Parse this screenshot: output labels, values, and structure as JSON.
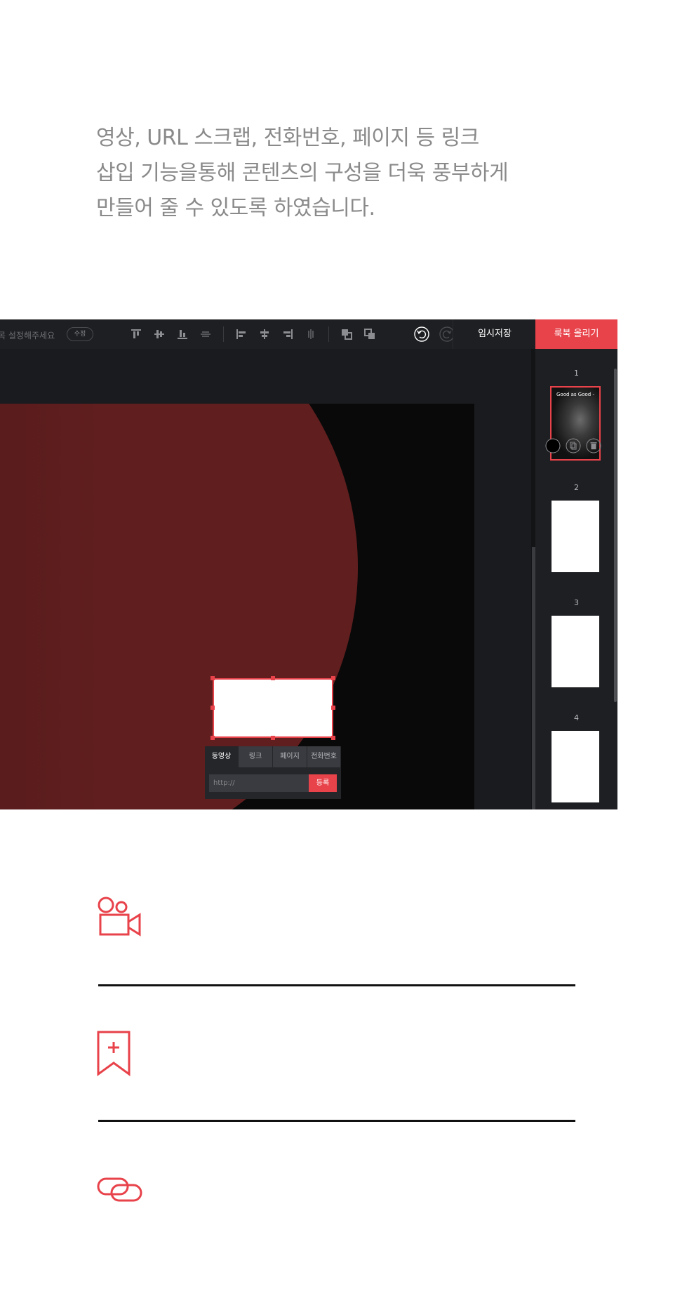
{
  "intro": {
    "lines": [
      "영상, URL 스크랩, 전화번호, 페이지 등 링크",
      "삽입 기능을통해 콘텐츠의 구성을 더욱 풍부하게",
      "만들어 줄 수 있도록 하였습니다."
    ]
  },
  "editor": {
    "title_text": "제목 설정해주세요",
    "edit_label": "수정",
    "save_label": "임시저장",
    "upload_label": "룩북 올리기",
    "toolbar_icons": [
      "align-top-icon",
      "align-middle-icon",
      "align-bottom-icon",
      "distribute-vertical-icon",
      "align-left-icon",
      "align-center-icon",
      "align-right-icon",
      "distribute-horizontal-icon",
      "bring-forward-icon",
      "send-backward-icon",
      "undo-icon",
      "redo-icon"
    ],
    "link_panel": {
      "tabs": [
        "동영상",
        "링크",
        "페이지",
        "전화번호"
      ],
      "active_tab": "동영상",
      "input_placeholder": "http://",
      "submit_label": "등록"
    },
    "pages": [
      {
        "number": "1",
        "thumb_text": "Good as Good -"
      },
      {
        "number": "2"
      },
      {
        "number": "3"
      },
      {
        "number": "4"
      }
    ],
    "page_actions": [
      "color-circle-icon",
      "duplicate-icon",
      "delete-icon"
    ]
  },
  "features": [
    "video-camera-icon",
    "bookmark-add-icon",
    "link-icon"
  ],
  "colors": {
    "accent": "#e8424a",
    "intro_text": "#8a8a8a",
    "toolbar_bg": "#1e1f22",
    "canvas_bg": "#090909",
    "circle_red": "#611e1e"
  }
}
